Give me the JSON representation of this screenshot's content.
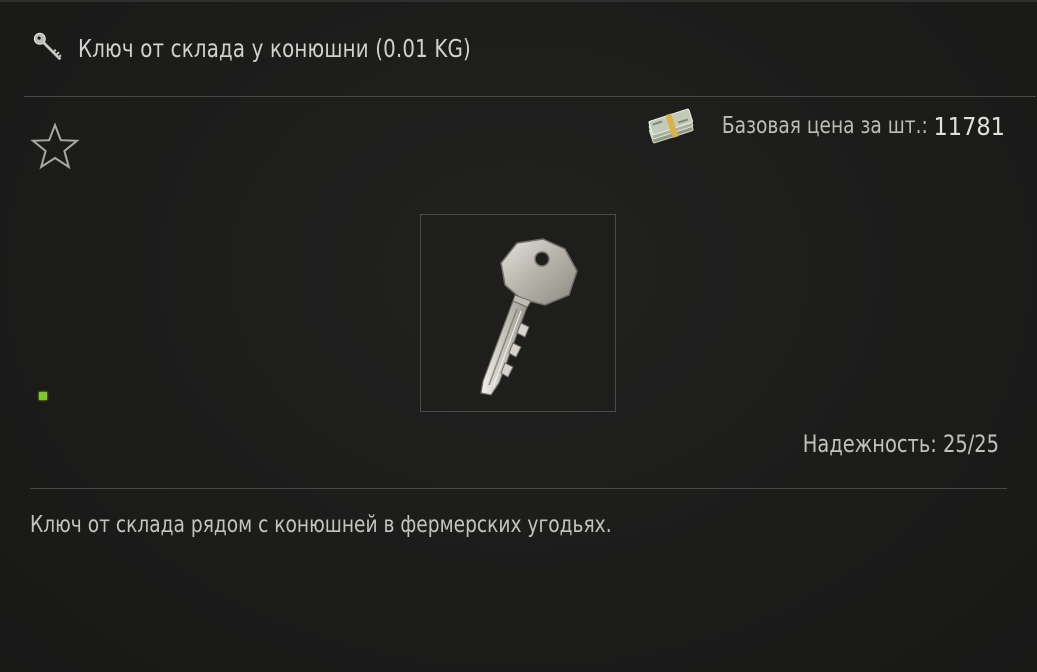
{
  "header": {
    "icon": "key-icon",
    "title": "Ключ от склада у конюшни (0.01 KG)"
  },
  "favorite": {
    "icon": "star-outline-icon"
  },
  "price": {
    "icon": "money-stack-icon",
    "label": "Базовая цена за шт.:",
    "value": "11781"
  },
  "item": {
    "image": "key-icon"
  },
  "status": {
    "color": "#7fc72a"
  },
  "durability": {
    "text": "Надежность: 25/25"
  },
  "description": {
    "text": "Ключ от склада рядом с конюшней в фермерских угодьях."
  }
}
